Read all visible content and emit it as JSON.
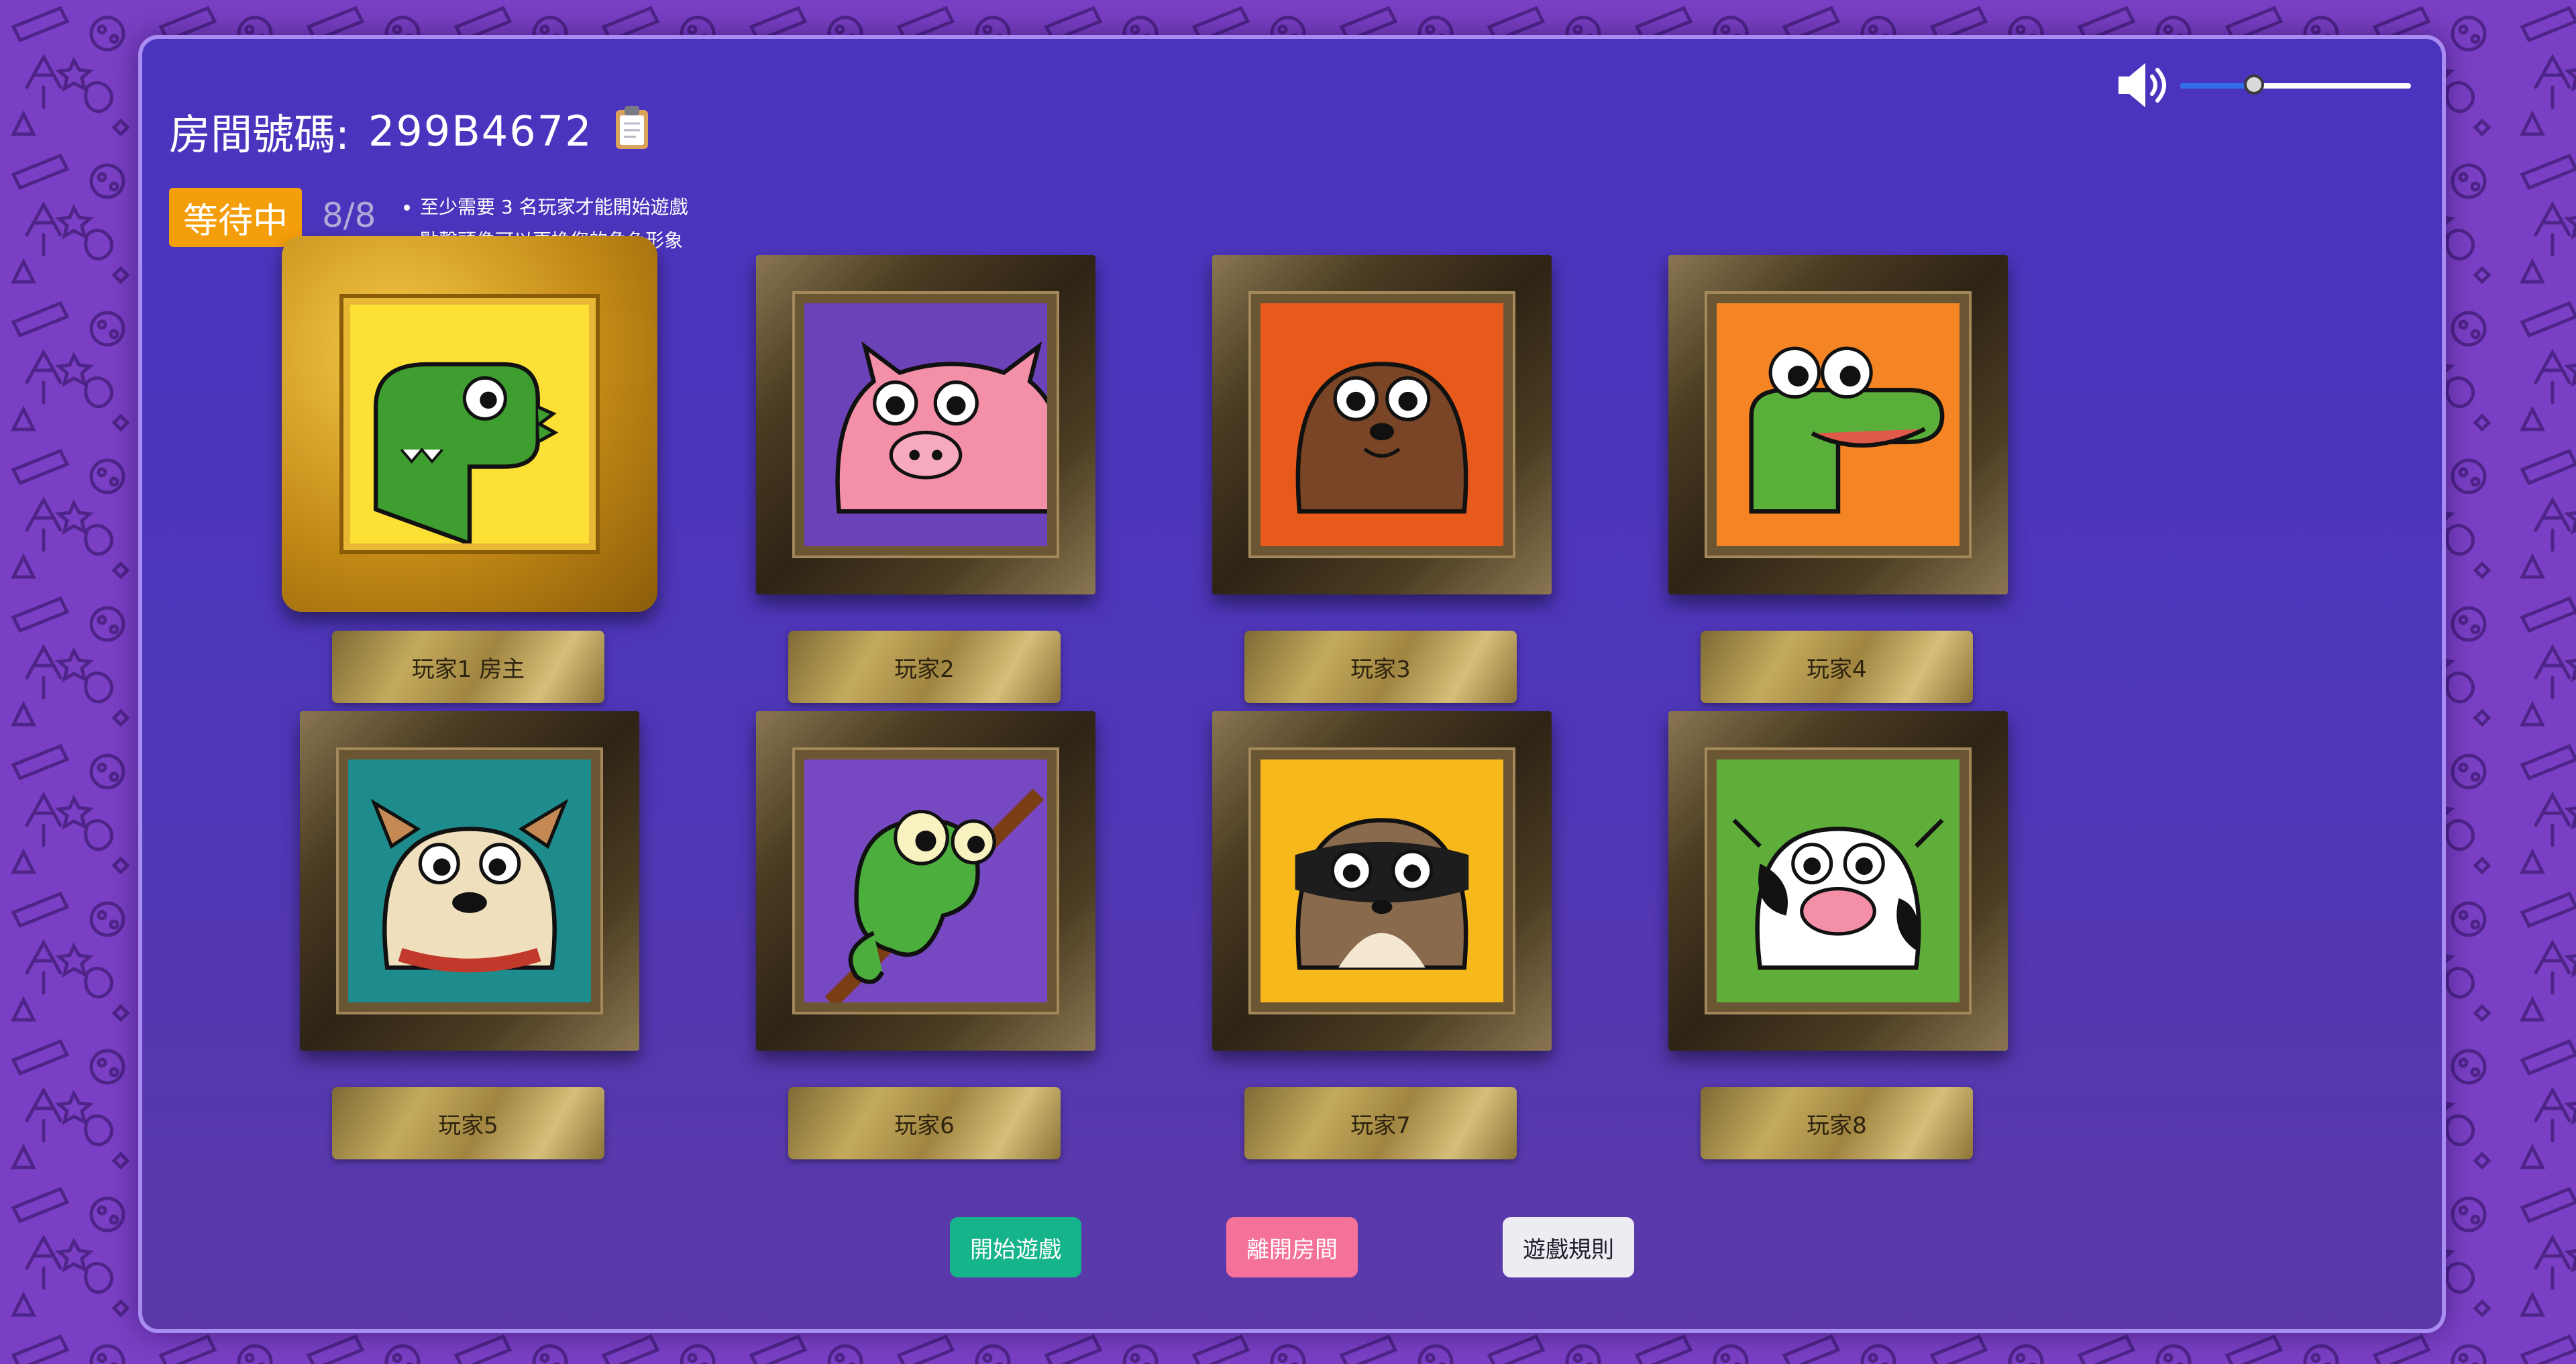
{
  "room": {
    "label": "房間號碼:",
    "code": "299B4672"
  },
  "status": {
    "badge": "等待中",
    "count": "8/8"
  },
  "hints": [
    "至少需要 3 名玩家才能開始遊戲",
    "點擊頭像可以更換您的角色形象"
  ],
  "volume": {
    "level": 0.32
  },
  "colors": {
    "background": "#7a3fc4",
    "panel": "#4a34bf",
    "status_badge": "#f59e0b",
    "start_button": "#16b48a",
    "leave_button": "#f47199",
    "rules_button": "#ececf2"
  },
  "players": [
    {
      "label": "玩家1 房主",
      "avatar": "dinosaur",
      "frame": "gold",
      "bg": "#fde036"
    },
    {
      "label": "玩家2",
      "avatar": "pig",
      "frame": "wood",
      "bg": "#6c42b8"
    },
    {
      "label": "玩家3",
      "avatar": "otter",
      "frame": "wood",
      "bg": "#e85a1c"
    },
    {
      "label": "玩家4",
      "avatar": "crocodile",
      "frame": "wood",
      "bg": "#f58424"
    },
    {
      "label": "玩家5",
      "avatar": "bulldog",
      "frame": "wood",
      "bg": "#1e8c8c"
    },
    {
      "label": "玩家6",
      "avatar": "chameleon",
      "frame": "wood",
      "bg": "#7648c2"
    },
    {
      "label": "玩家7",
      "avatar": "raccoon",
      "frame": "wood",
      "bg": "#f7b81c"
    },
    {
      "label": "玩家8",
      "avatar": "cow",
      "frame": "wood",
      "bg": "#5fae3a"
    }
  ],
  "buttons": {
    "start": "開始遊戲",
    "leave": "離開房間",
    "rules": "遊戲規則"
  }
}
